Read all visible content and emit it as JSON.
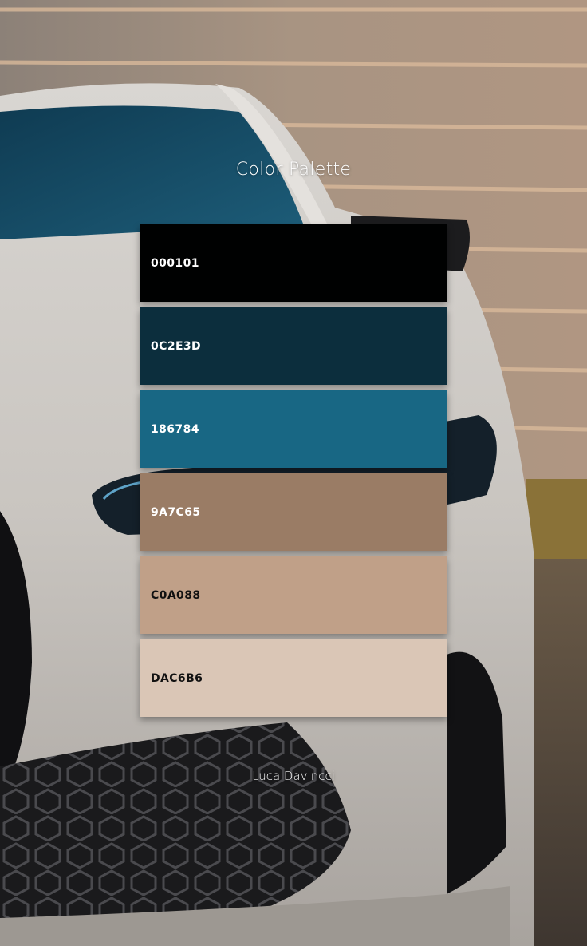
{
  "title": "Color Palette",
  "author": "Luca Davincci",
  "swatches": [
    {
      "code": "000101",
      "color": "#000101",
      "text_color": "#ffffff"
    },
    {
      "code": "0C2E3D",
      "color": "#0C2E3D",
      "text_color": "#ffffff"
    },
    {
      "code": "186784",
      "color": "#186784",
      "text_color": "#ffffff"
    },
    {
      "code": "9A7C65",
      "color": "#9A7C65",
      "text_color": "#ffffff"
    },
    {
      "code": "C0A088",
      "color": "#C0A088",
      "text_color": "#111111"
    },
    {
      "code": "DAC6B6",
      "color": "#DAC6B6",
      "text_color": "#111111"
    }
  ]
}
